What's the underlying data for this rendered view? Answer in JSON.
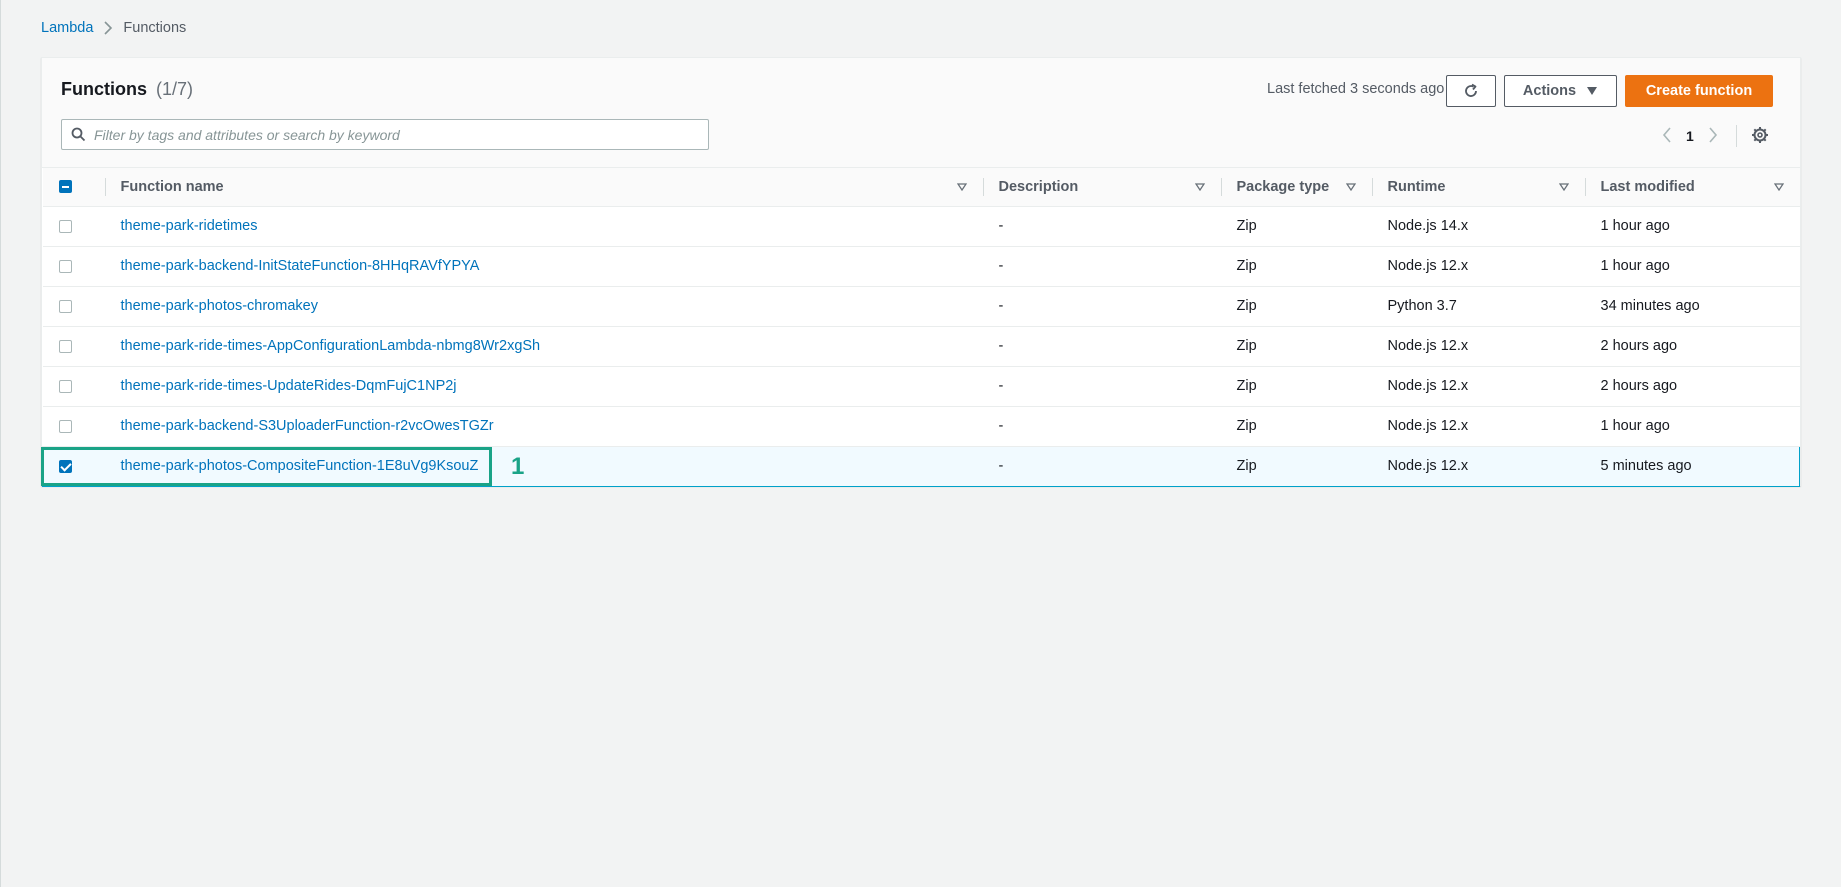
{
  "breadcrumb": {
    "root": "Lambda",
    "current": "Functions"
  },
  "panel": {
    "title": "Functions",
    "count": "(1/7)",
    "last_fetched": "Last fetched 3 seconds ago",
    "actions_label": "Actions",
    "create_label": "Create function",
    "search_placeholder": "Filter by tags and attributes or search by keyword",
    "page_number": "1"
  },
  "table": {
    "columns": {
      "name": "Function name",
      "description": "Description",
      "package_type": "Package type",
      "runtime": "Runtime",
      "last_modified": "Last modified"
    },
    "rows": [
      {
        "name": "theme-park-ridetimes",
        "description": "-",
        "package_type": "Zip",
        "runtime": "Node.js 14.x",
        "last_modified": "1 hour ago"
      },
      {
        "name": "theme-park-backend-InitStateFunction-8HHqRAVfYPYA",
        "description": "-",
        "package_type": "Zip",
        "runtime": "Node.js 12.x",
        "last_modified": "1 hour ago"
      },
      {
        "name": "theme-park-photos-chromakey",
        "description": "-",
        "package_type": "Zip",
        "runtime": "Python 3.7",
        "last_modified": "34 minutes ago"
      },
      {
        "name": "theme-park-ride-times-AppConfigurationLambda-nbmg8Wr2xgSh",
        "description": "-",
        "package_type": "Zip",
        "runtime": "Node.js 12.x",
        "last_modified": "2 hours ago"
      },
      {
        "name": "theme-park-ride-times-UpdateRides-DqmFujC1NP2j",
        "description": "-",
        "package_type": "Zip",
        "runtime": "Node.js 12.x",
        "last_modified": "2 hours ago"
      },
      {
        "name": "theme-park-backend-S3UploaderFunction-r2vcOwesTGZr",
        "description": "-",
        "package_type": "Zip",
        "runtime": "Node.js 12.x",
        "last_modified": "1 hour ago"
      },
      {
        "name": "theme-park-photos-CompositeFunction-1E8uVg9KsouZ",
        "description": "-",
        "package_type": "Zip",
        "runtime": "Node.js 12.x",
        "last_modified": "5 minutes ago"
      }
    ]
  },
  "annotation": {
    "label": "1",
    "color": "#1aa387"
  },
  "colors": {
    "link": "#0073bb",
    "primary_button": "#ec7211"
  }
}
